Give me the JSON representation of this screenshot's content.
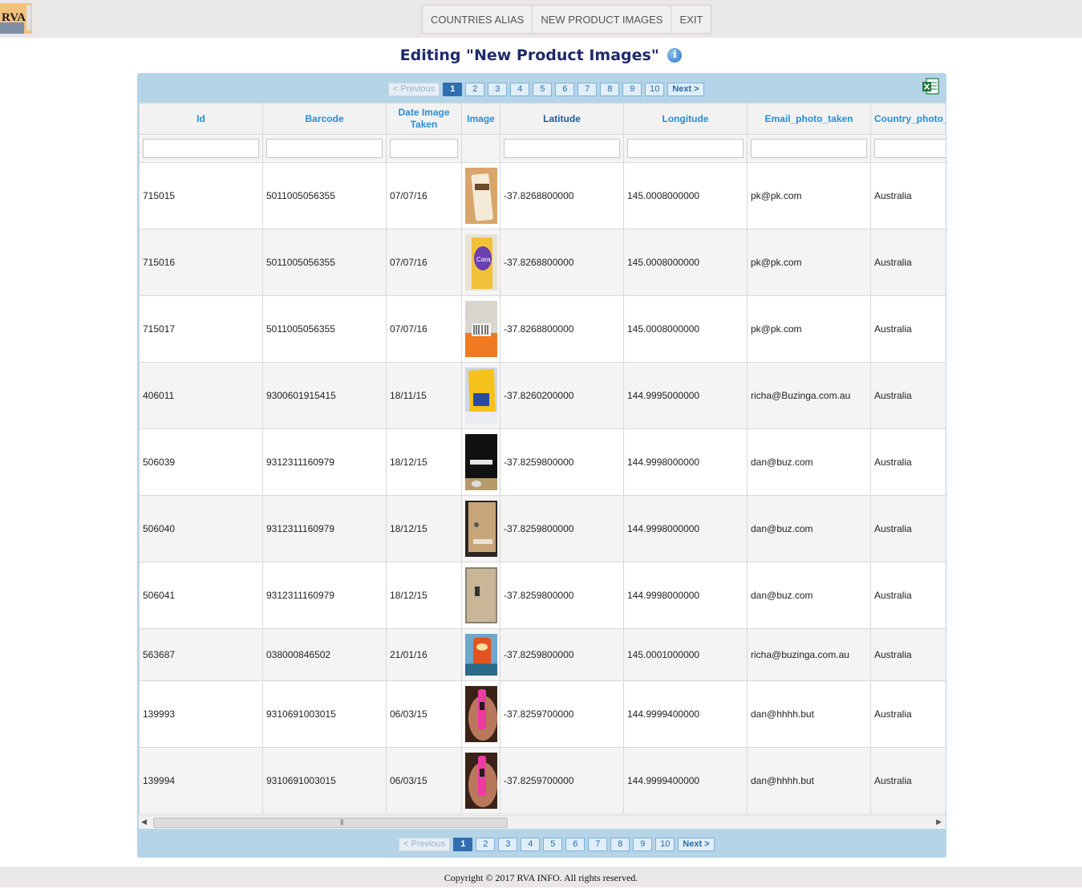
{
  "logo_text": "RVA",
  "menu": [
    {
      "label": "COUNTRIES ALIAS"
    },
    {
      "label": "NEW PRODUCT IMAGES"
    },
    {
      "label": "EXIT"
    }
  ],
  "page_title": "Editing \"New Product Images\"",
  "info_icon": "i",
  "pager": {
    "previous": "< Previous",
    "next": "Next >",
    "pages": [
      "1",
      "2",
      "3",
      "4",
      "5",
      "6",
      "7",
      "8",
      "9",
      "10"
    ],
    "current": "1"
  },
  "columns": [
    "Id",
    "Barcode",
    "Date Image Taken",
    "Image",
    "Latitude",
    "Longitude",
    "Email_photo_taken",
    "Country_photo_taken"
  ],
  "rows": [
    {
      "id": "715015",
      "barcode": "5011005056355",
      "date": "07/07/16",
      "lat": "-37.8268800000",
      "lon": "145.0008000000",
      "email": "pk@pk.com",
      "country": "Australia",
      "thumb": "cream-bar"
    },
    {
      "id": "715016",
      "barcode": "5011005056355",
      "date": "07/07/16",
      "lat": "-37.8268800000",
      "lon": "145.0008000000",
      "email": "pk@pk.com",
      "country": "Australia",
      "thumb": "yellow-wrapper"
    },
    {
      "id": "715017",
      "barcode": "5011005056355",
      "date": "07/07/16",
      "lat": "-37.8268800000",
      "lon": "145.0008000000",
      "email": "pk@pk.com",
      "country": "Australia",
      "thumb": "barcode-orange"
    },
    {
      "id": "406011",
      "barcode": "9300601915415",
      "date": "18/11/15",
      "lat": "-37.8260200000",
      "lon": "144.9995000000",
      "email": "richa@Buzinga.com.au",
      "country": "Australia",
      "thumb": "chips-bag"
    },
    {
      "id": "506039",
      "barcode": "9312311160979",
      "date": "18/12/15",
      "lat": "-37.8259800000",
      "lon": "144.9998000000",
      "email": "dan@buz.com",
      "country": "Australia",
      "thumb": "black-box"
    },
    {
      "id": "506040",
      "barcode": "9312311160979",
      "date": "18/12/15",
      "lat": "-37.8259800000",
      "lon": "144.9998000000",
      "email": "dan@buz.com",
      "country": "Australia",
      "thumb": "brown-box"
    },
    {
      "id": "506041",
      "barcode": "9312311160979",
      "date": "18/12/15",
      "lat": "-37.8259800000",
      "lon": "144.9998000000",
      "email": "dan@buz.com",
      "country": "Australia",
      "thumb": "grey-box"
    },
    {
      "id": "563687",
      "barcode": "038000846502",
      "date": "21/01/16",
      "lat": "-37.8259800000",
      "lon": "145.0001000000",
      "email": "richa@buzinga.com.au",
      "country": "Australia",
      "thumb": "pringles-can"
    },
    {
      "id": "139993",
      "barcode": "9310691003015",
      "date": "06/03/15",
      "lat": "-37.8259700000",
      "lon": "144.9999400000",
      "email": "dan@hhhh.but",
      "country": "Australia",
      "thumb": "pink-highlighter"
    },
    {
      "id": "139994",
      "barcode": "9310691003015",
      "date": "06/03/15",
      "lat": "-37.8259700000",
      "lon": "144.9999400000",
      "email": "dan@hhhh.but",
      "country": "Australia",
      "thumb": "pink-highlighter"
    }
  ],
  "footer": "Copyright © 2017 RVA INFO. All rights reserved."
}
